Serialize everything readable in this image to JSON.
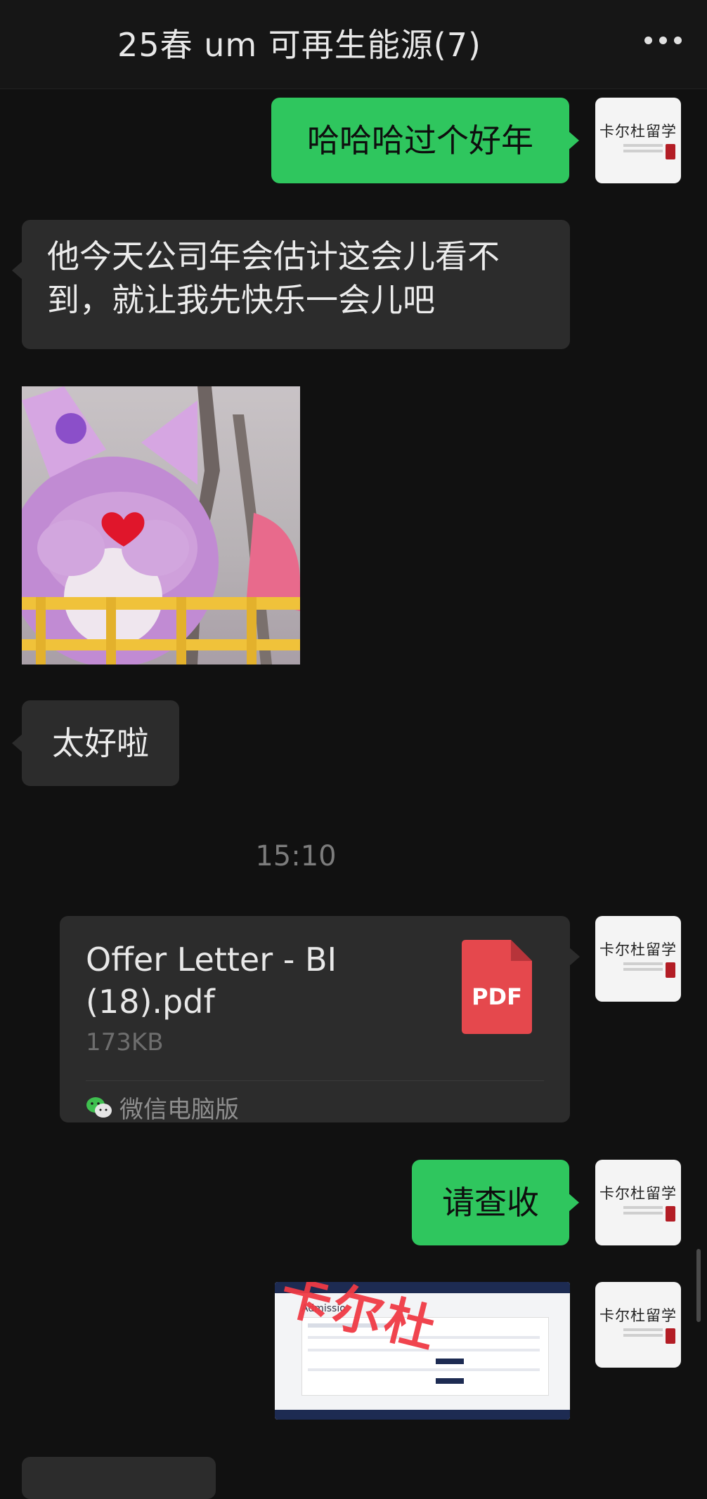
{
  "header": {
    "title": "25春 um 可再生能源(7)",
    "more_icon": "ellipsis-icon"
  },
  "avatar": {
    "text": "卡尔杜留学",
    "seal_color": "#b31d25"
  },
  "messages": {
    "m1": {
      "text": "哈哈哈过个好年",
      "sender": "me"
    },
    "m2": {
      "text": "他今天公司年会估计这会儿看不到，就让我先快乐一会儿吧",
      "sender": "other"
    },
    "m3": {
      "type": "sticker",
      "sender": "other"
    },
    "m4": {
      "text": "太好啦",
      "sender": "other"
    },
    "time": "15:10",
    "file": {
      "name": "Offer Letter - BI (18).pdf",
      "size": "173KB",
      "badge": "PDF",
      "source": "微信电脑版",
      "source_icon": "wechat-icon"
    },
    "m6": {
      "text": "请查收",
      "sender": "me"
    },
    "m7": {
      "type": "screenshot",
      "watermark": "卡尔杜",
      "heading": "Admissio"
    }
  },
  "colors": {
    "my_bubble": "#2fc65e",
    "other_bubble": "#2c2c2c",
    "background": "#111111",
    "pdf_red": "#e5484d"
  }
}
